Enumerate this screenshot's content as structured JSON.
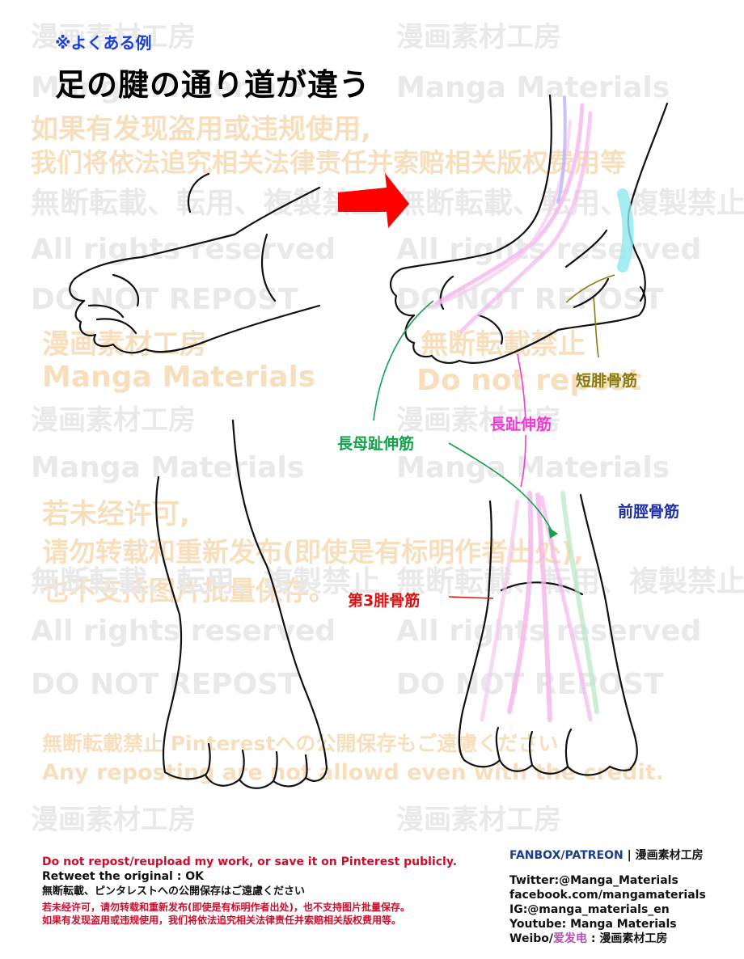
{
  "header": {
    "subtitle": "※よくある例",
    "title": "足の腱の通り道が違う"
  },
  "watermarks": {
    "studio_jp": "漫画素材工房",
    "studio_en": "Manga Materials",
    "cn_line1": "如果有发现盗用或违规使用,",
    "cn_line2": "我们将依法追究相关法律责任并索赔相关版权费用等",
    "jp_forbidden": "無断転載、転用、複製禁止",
    "all_rights": "All rights reserved",
    "do_not_repost": "DO NOT REPOST",
    "jp_no_repost": "無断転載禁止",
    "do_not_repost_2": "Do not repost",
    "cn2_line1": "若未经许可,",
    "cn2_line2": "请勿转载和重新发布(即使是有标明作者出处),",
    "cn2_line3": "也不支持图片批量保存。",
    "pinterest_jp": "無断転載禁止 Pinterestへの公開保存もご遠慮ください",
    "any_reposting": "Any reposting are not allowd even with the credit."
  },
  "labels": {
    "ehl": "長母趾伸筋",
    "edl": "長趾伸筋",
    "pb": "短腓骨筋",
    "ta": "前脛骨筋",
    "pt": "第3腓骨筋"
  },
  "colors": {
    "title_blue": "#1a3fd6",
    "arrow_red": "#ff0000",
    "ehl_green": "#12a24a",
    "edl_magenta": "#f03cd6",
    "pb_olive": "#8a7a10",
    "ta_navy": "#1c2fa8",
    "pt_red": "#e01010",
    "footer_red": "#c8102e"
  },
  "footer": {
    "line1": "Do not repost/reupload my work, or save it on Pinterest publicly.",
    "line2": "Retweet the original : OK",
    "line3": "無断転載、ピンタレストへの公開保存はご遠慮ください",
    "line4": "若未经许可，请勿转载和重新发布(即使是有标明作者出处)，也不支持图片批量保存。",
    "line5": "如果有发现盗用或违规使用，我们将依法追究相关法律责任并索赔相关版权费用等。",
    "fanbox_patreon": "FANBOX/PATREON",
    "fanbox_sep": "|",
    "fanbox_name": "漫画素材工房",
    "twitter": "Twitter:@Manga_Materials",
    "facebook": "facebook.com/mangamaterials",
    "instagram": "IG:@manga_materials_en",
    "youtube": "Youtube: Manga Materials",
    "weibo_label": "Weibo/",
    "weibo_alt": "爱发电",
    "weibo_name": ": 漫画素材工房"
  }
}
